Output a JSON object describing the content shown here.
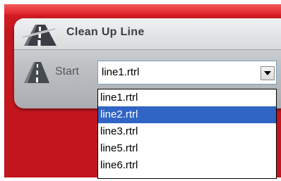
{
  "window": {
    "title": "Clean Up Line"
  },
  "start_field": {
    "label": "Start",
    "value": "line1.rtrl",
    "options": [
      "line1.rtrl",
      "line2.rtrl",
      "line3.rtrl",
      "line5.rtrl",
      "line6.rtrl"
    ],
    "highlighted_index": 1
  },
  "colors": {
    "backdrop": "#c4161e",
    "panel": "#c8cacd",
    "selection": "#3165c5"
  }
}
